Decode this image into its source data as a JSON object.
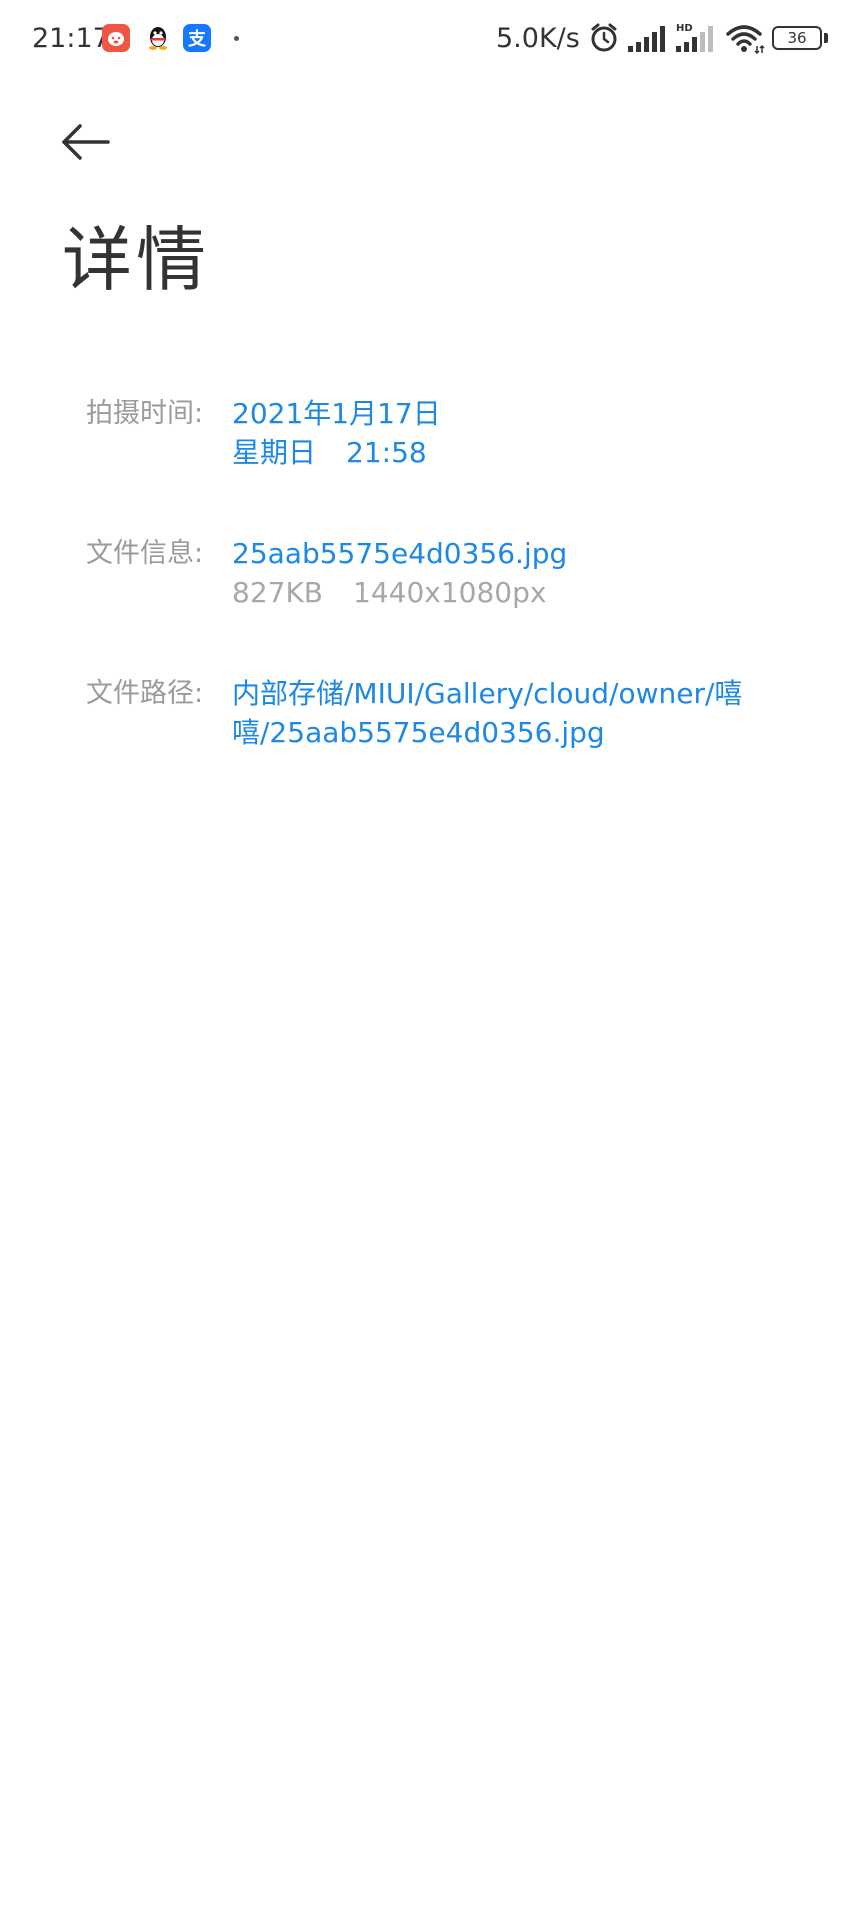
{
  "status_bar": {
    "time": "21:17",
    "net_speed": "5.0K/s",
    "battery": "36",
    "icons": [
      "app-notification-icon",
      "qq-icon",
      "alipay-icon",
      "alarm-icon",
      "signal-icon",
      "hd-signal-icon",
      "wifi-icon",
      "battery-icon"
    ],
    "alipay_glyph": "支"
  },
  "header": {
    "title": "详情"
  },
  "details": {
    "capture_time": {
      "label": "拍摄时间:",
      "date": "2021年1月17日",
      "weekday": "星期日",
      "time": "21:58"
    },
    "file_info": {
      "label": "文件信息:",
      "filename": "25aab5575e4d0356.jpg",
      "size": "827KB",
      "resolution": "1440x1080px"
    },
    "file_path": {
      "label": "文件路径:",
      "path_line1": "内部存储/MIUI/Gallery/cloud/owner/嘻",
      "path_line2": "嘻/25aab5575e4d0356.jpg"
    }
  },
  "colors": {
    "accent": "#1e88e5",
    "label": "#9b9b9b",
    "muted_value": "#a8a8a8",
    "title": "#333333"
  }
}
